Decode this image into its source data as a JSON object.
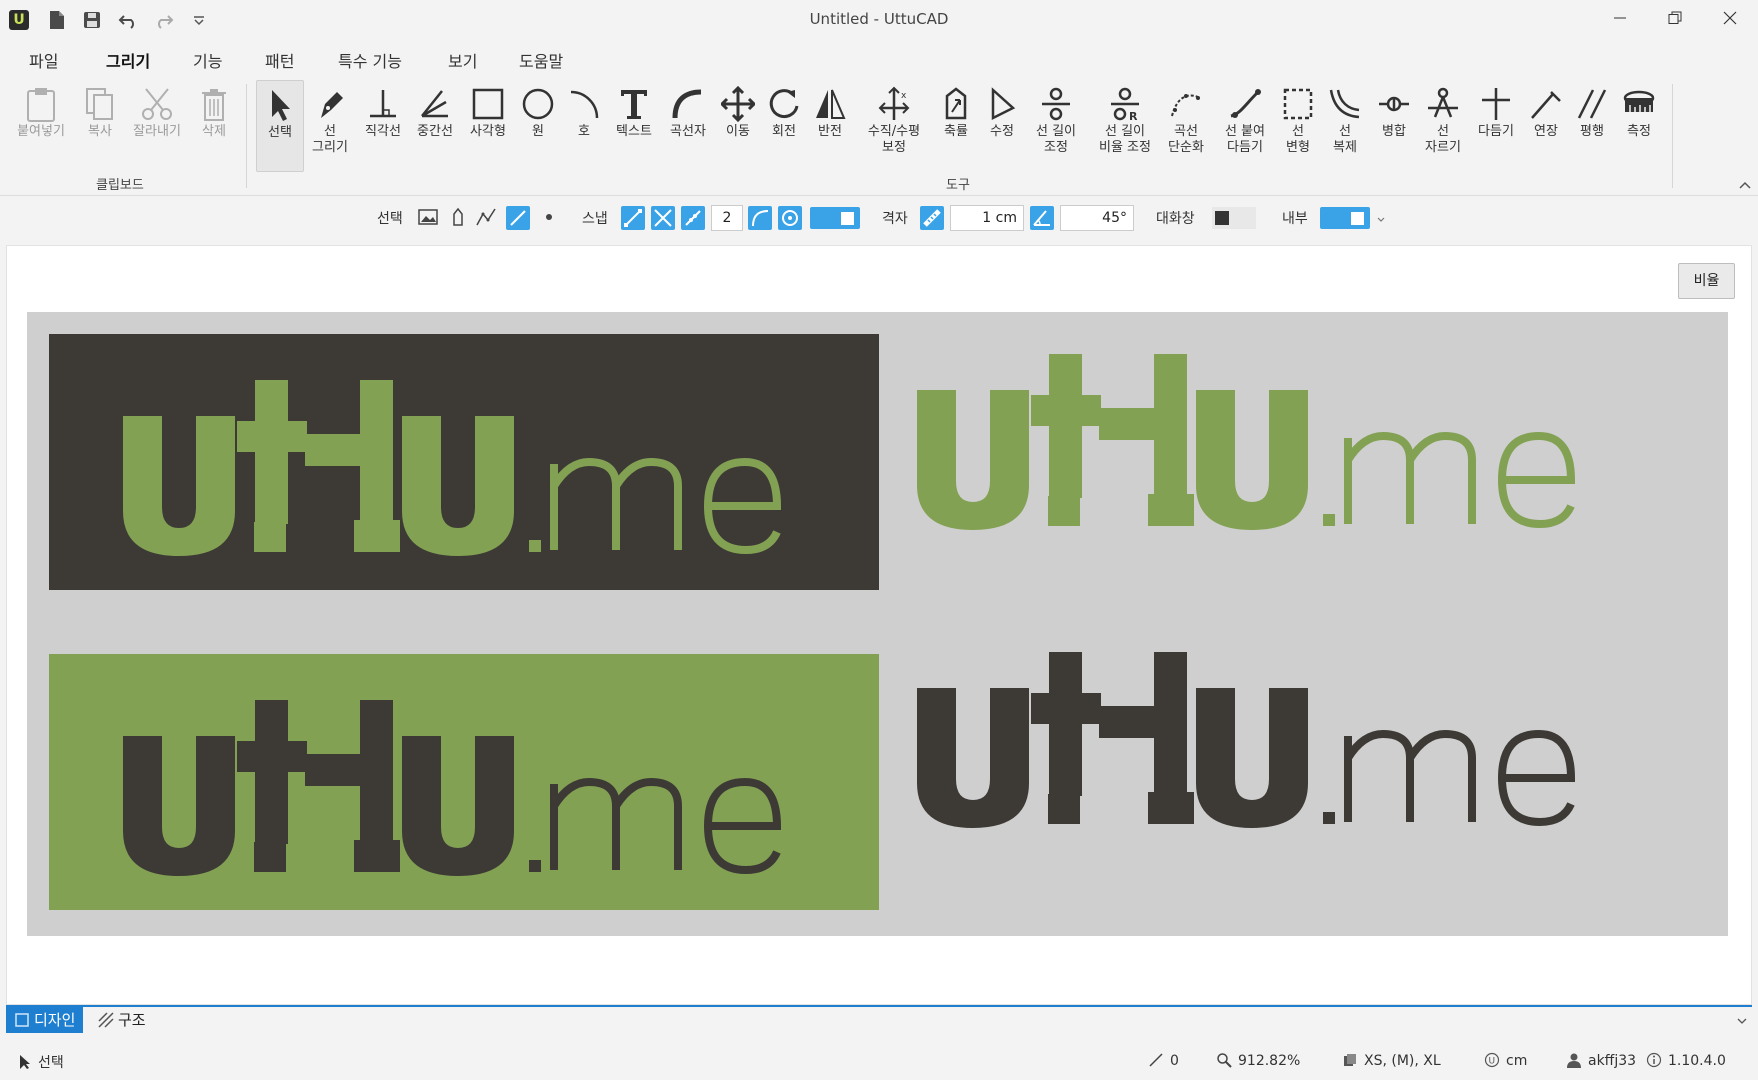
{
  "window": {
    "title": "Untitled - UttuCAD",
    "app_logo_letter": "U"
  },
  "menu": {
    "tabs": [
      "파일",
      "그리기",
      "기능",
      "패턴",
      "특수 기능",
      "보기",
      "도움말"
    ],
    "active": "그리기"
  },
  "ribbon": {
    "clipboard": {
      "label": "클립보드",
      "items": [
        "붙여넣기",
        "복사",
        "잘라내기",
        "삭제"
      ]
    },
    "tools": {
      "label": "도구",
      "items": [
        [
          "선택"
        ],
        [
          "선",
          "그리기"
        ],
        [
          "직각선"
        ],
        [
          "중간선"
        ],
        [
          "사각형"
        ],
        [
          "원"
        ],
        [
          "호"
        ],
        [
          "텍스트"
        ],
        [
          "곡선자"
        ],
        [
          "이동"
        ],
        [
          "회전"
        ],
        [
          "반전"
        ],
        [
          "수직/수평",
          "보정"
        ],
        [
          "축률"
        ],
        [
          "수정"
        ],
        [
          "선 길이",
          "조정"
        ],
        [
          "선 길이",
          "비율 조정"
        ],
        [
          "곡선",
          "단순화"
        ],
        [
          "선 붙여",
          "다듬기"
        ],
        [
          "선",
          "변형"
        ],
        [
          "선",
          "복제"
        ],
        [
          "병합"
        ],
        [
          "선",
          "자르기"
        ],
        [
          "다듬기"
        ],
        [
          "연장"
        ],
        [
          "평행"
        ],
        [
          "측정"
        ]
      ]
    }
  },
  "optionbar": {
    "select_label": "선택",
    "snap_label": "스냅",
    "snap_count": "2",
    "grid_label": "격자",
    "grid_size": "1 cm",
    "angle": "45°",
    "dialog_label": "대화창",
    "inner_label": "내부"
  },
  "canvas": {
    "ratio_button": "비율",
    "logo_text": "UttU.me",
    "colors": {
      "green": "#82a153",
      "dark": "#3d3a36",
      "artboard": "#cfcfcf"
    }
  },
  "viewtabs": {
    "design": "디자인",
    "structure": "구조"
  },
  "status": {
    "mode": "선택",
    "lines": "0",
    "zoom": "912.82%",
    "sizes": "XS, (M), XL",
    "unit": "cm",
    "user": "akffj33",
    "version": "1.10.4.0"
  }
}
